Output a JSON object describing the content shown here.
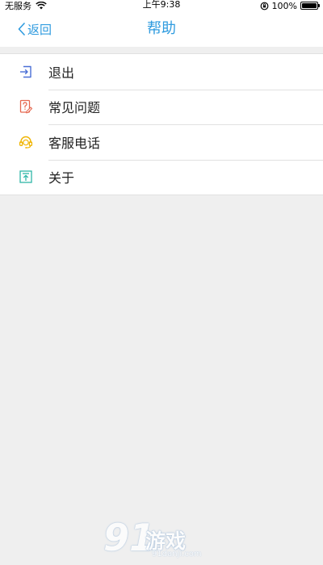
{
  "status_bar": {
    "carrier": "无服务",
    "time": "上午9:38",
    "battery_text": "100%",
    "wifi_icon": "wifi-icon",
    "lock_icon": "orientation-lock-icon"
  },
  "nav": {
    "back_label": "返回",
    "title": "帮助"
  },
  "menu": {
    "items": [
      {
        "label": "退出",
        "icon": "logout-icon",
        "color": "#4a6fd6"
      },
      {
        "label": "常见问题",
        "icon": "faq-icon",
        "color": "#e5674f"
      },
      {
        "label": "客服电话",
        "icon": "headset-icon",
        "color": "#f0b400"
      },
      {
        "label": "关于",
        "icon": "about-icon",
        "color": "#2fb6a8"
      }
    ]
  },
  "watermark": {
    "number": "91",
    "text": "游戏",
    "url": "91danji.com"
  },
  "colors": {
    "accent": "#2f9bdf",
    "background": "#efefef"
  }
}
